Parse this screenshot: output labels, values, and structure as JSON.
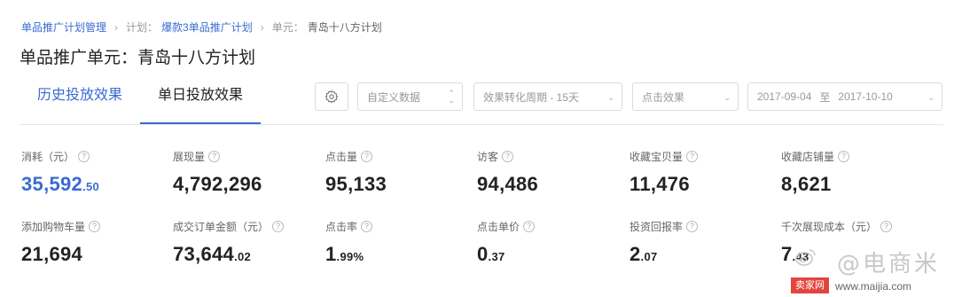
{
  "breadcrumb": {
    "root": "单品推广计划管理",
    "plan_prefix": "计划：",
    "plan": "爆款3单品推广计划",
    "unit_prefix": "单元：",
    "unit": "青岛十八方计划"
  },
  "page_title": "单品推广单元：青岛十八方计划",
  "tabs": [
    {
      "label": "历史投放效果",
      "active": false
    },
    {
      "label": "单日投放效果",
      "active": true
    }
  ],
  "controls": {
    "custom_data": "自定义数据",
    "conversion_period": "效果转化周期 - 15天",
    "effect_type": "点击效果",
    "date_start": "2017-09-04",
    "date_sep": "至",
    "date_end": "2017-10-10"
  },
  "metrics": [
    {
      "label": "消耗（元）",
      "int": "35,592",
      "dec": ".50",
      "highlight": true
    },
    {
      "label": "展现量",
      "int": "4,792,296",
      "dec": ""
    },
    {
      "label": "点击量",
      "int": "95,133",
      "dec": ""
    },
    {
      "label": "访客",
      "int": "94,486",
      "dec": ""
    },
    {
      "label": "收藏宝贝量",
      "int": "11,476",
      "dec": ""
    },
    {
      "label": "收藏店铺量",
      "int": "8,621",
      "dec": ""
    },
    {
      "label": "添加购物车量",
      "int": "21,694",
      "dec": ""
    },
    {
      "label": "成交订单金额（元）",
      "int": "73,644",
      "dec": ".02"
    },
    {
      "label": "点击率",
      "int": "1",
      "dec": ".99%"
    },
    {
      "label": "点击单价",
      "int": "0",
      "dec": ".37"
    },
    {
      "label": "投资回报率",
      "int": "2",
      "dec": ".07"
    },
    {
      "label": "千次展现成本（元）",
      "int": "7",
      "dec": ".43"
    }
  ],
  "help_glyph": "?",
  "watermark": {
    "text": "@电商米",
    "badge": "卖家网",
    "url": "www.maijia.com"
  },
  "colors": {
    "accent": "#3a6bd1",
    "text": "#222222",
    "muted": "#999999",
    "border": "#dcdcdc",
    "badge": "#e2453c"
  }
}
